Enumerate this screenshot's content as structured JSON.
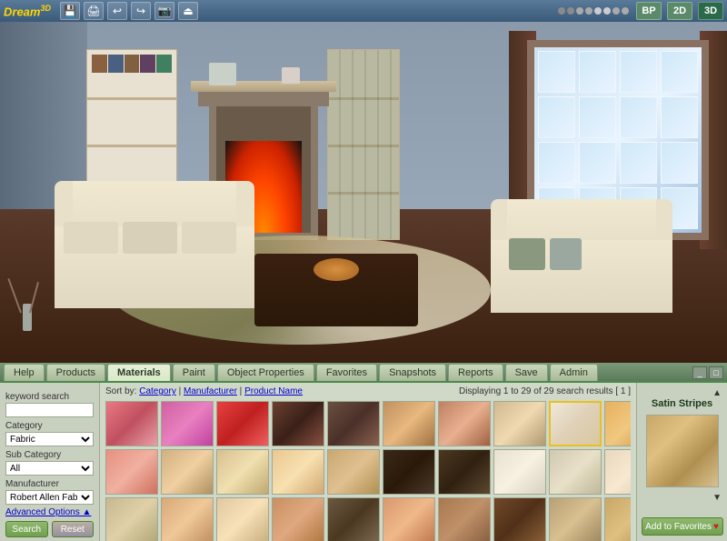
{
  "app": {
    "title": "Dream",
    "title_suffix": "3D",
    "logo_label": "Dream"
  },
  "toolbar": {
    "icons": [
      "💾",
      "🖨",
      "↩",
      "↪",
      "📷",
      "⏏"
    ],
    "view_buttons": [
      "BP",
      "2D",
      "3D"
    ]
  },
  "nav": {
    "tabs": [
      "Help",
      "Products",
      "Materials",
      "Paint",
      "Object Properties",
      "Favorites",
      "Snapshots",
      "Reports",
      "Save",
      "Admin"
    ]
  },
  "sidebar": {
    "keyword_label": "keyword search",
    "category_label": "Category",
    "category_value": "Fabric",
    "subcategory_label": "Sub Category",
    "subcategory_value": "All",
    "manufacturer_label": "Manufacturer",
    "manufacturer_value": "Robert Allen Fabrics",
    "advanced_link": "Advanced Options ▲",
    "search_btn": "Search",
    "reset_btn": "Reset"
  },
  "main": {
    "sort_label": "Sort by:",
    "sort_links": [
      "Category",
      "Manufacturer",
      "Product Name"
    ],
    "results_text": "Displaying 1 to 29 of 29 search results [ 1 ]",
    "swatches": [
      "sw1",
      "sw2",
      "sw3",
      "sw4",
      "sw5",
      "sw6",
      "sw7",
      "sw8",
      "sw9",
      "sw10",
      "sw11",
      "sw12",
      "sw13",
      "sw14",
      "sw15",
      "sw16",
      "sw17",
      "sw18",
      "sw19",
      "sw20",
      "sw21",
      "sw22",
      "sw23",
      "sw24",
      "sw25",
      "sw26",
      "sw27",
      "sw28",
      "sw29",
      "sw30"
    ],
    "selected_index": 8
  },
  "right_panel": {
    "title": "Satin Stripes",
    "add_fav_label": "Add to Favorites",
    "heart": "♥"
  }
}
